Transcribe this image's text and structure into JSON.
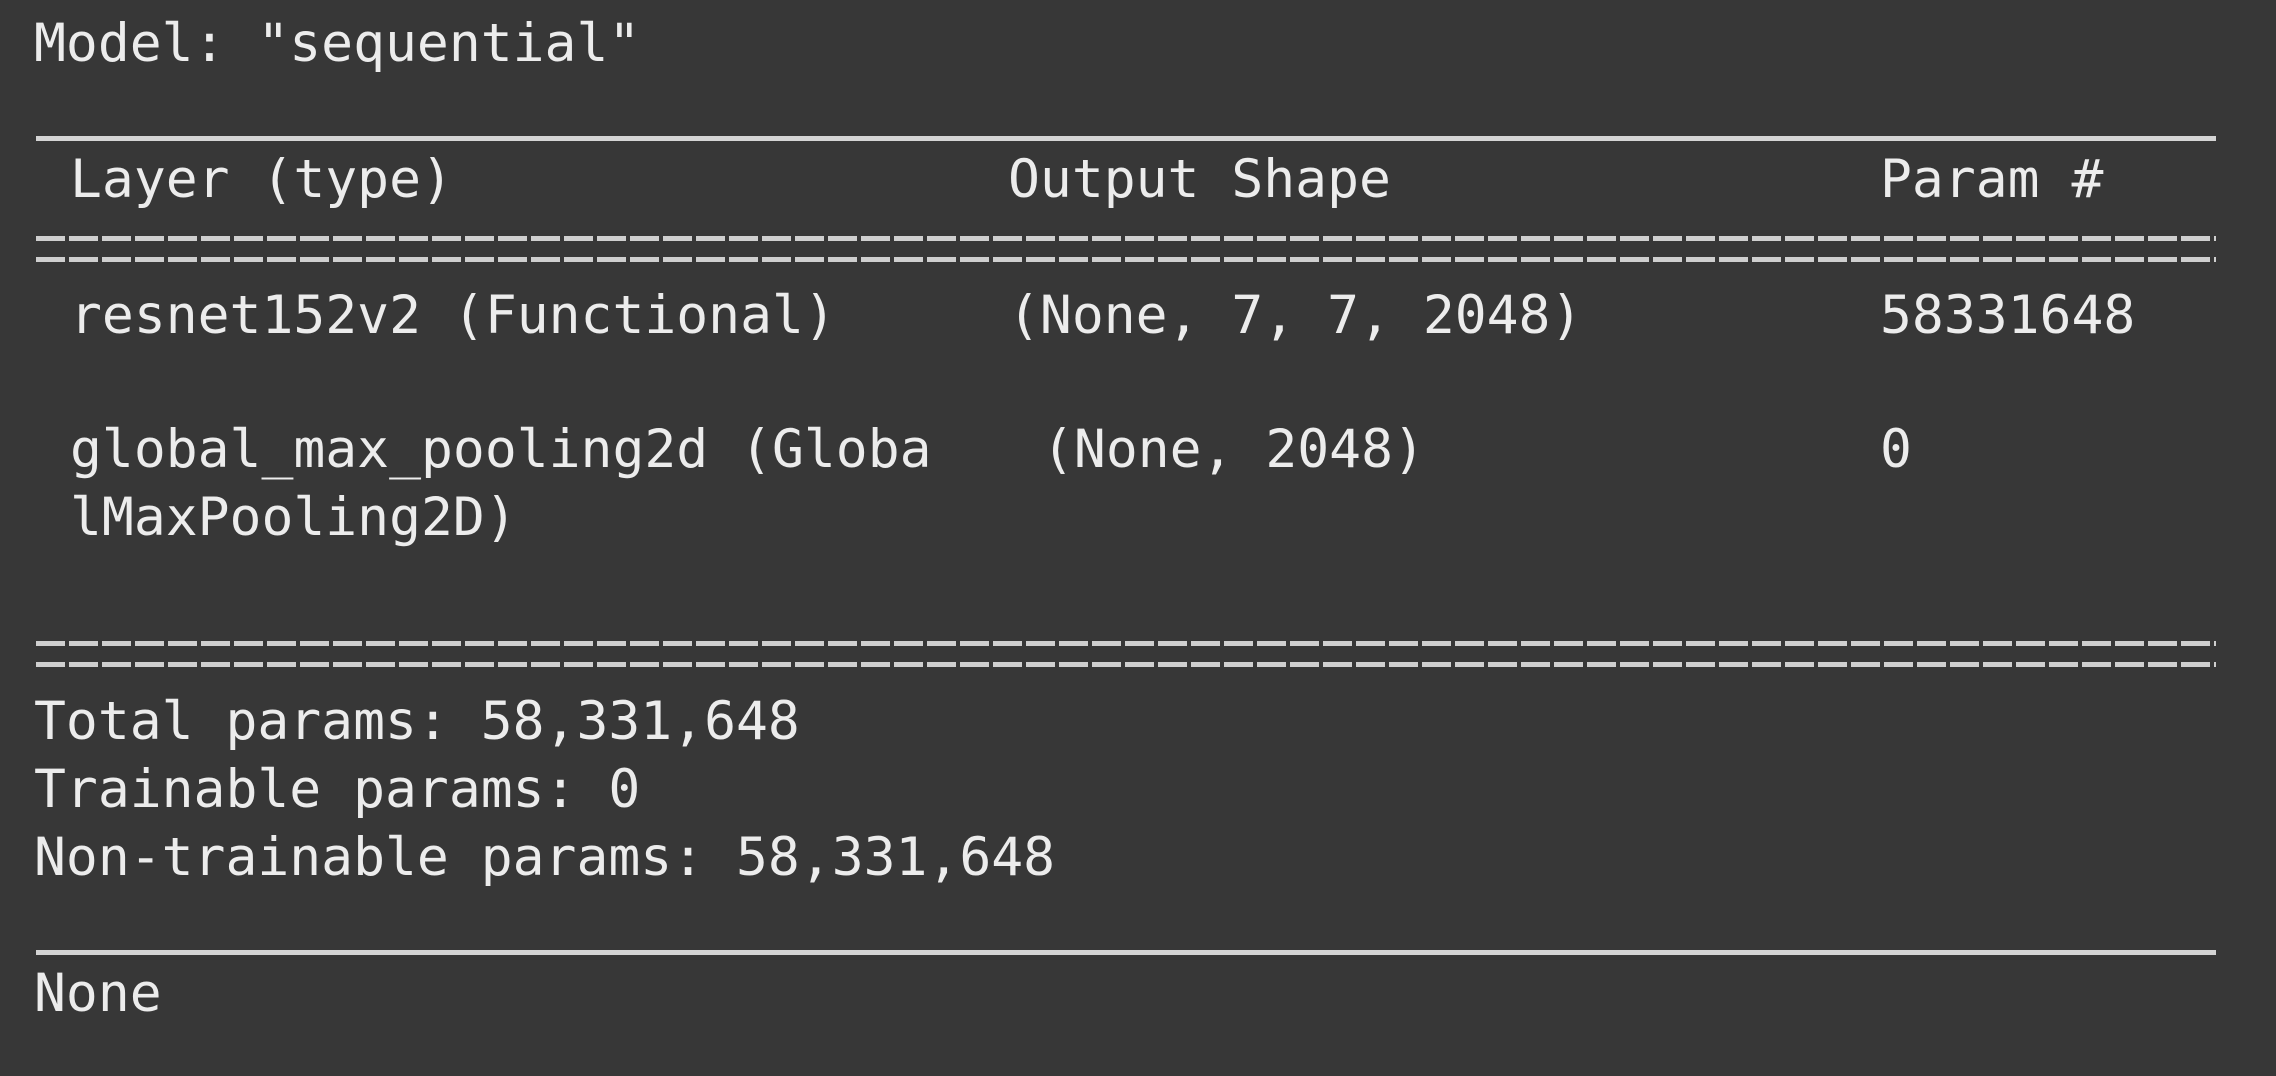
{
  "model_title": "Model: \"sequential\"",
  "clipped_top_text": "",
  "table": {
    "headers": {
      "layer": "Layer (type)",
      "output_shape": "Output Shape",
      "params": "Param #"
    },
    "rows": [
      {
        "layer_line1": "resnet152v2 (Functional)",
        "layer_line2": "",
        "output_shape": "(None, 7, 7, 2048)",
        "params": "58331648"
      },
      {
        "layer_line1": "global_max_pooling2d (Globa",
        "layer_line2": "lMaxPooling2D)",
        "output_shape": "(None, 2048)",
        "params": "0"
      }
    ]
  },
  "summary": {
    "total": "Total params: 58,331,648",
    "trainable": "Trainable params: 0",
    "non_trainable": "Non-trainable params: 58,331,648"
  },
  "return_value": "None"
}
